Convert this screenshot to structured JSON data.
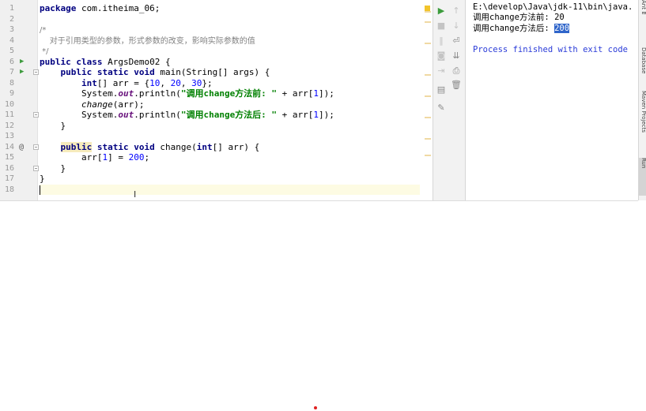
{
  "editor": {
    "line_numbers": [
      "1",
      "2",
      "3",
      "4",
      "5",
      "6",
      "7",
      "8",
      "9",
      "10",
      "11",
      "12",
      "13",
      "14",
      "15",
      "16",
      "17",
      "18"
    ],
    "lines": [
      [
        {
          "t": "package",
          "c": "kw"
        },
        {
          "t": " com.itheima_06;",
          "c": ""
        }
      ],
      [],
      [
        {
          "t": "/*",
          "c": "cmt"
        }
      ],
      [
        {
          "t": "    对于引用类型的参数，形式参数的改变，影响实际参数的值",
          "c": "cmt"
        }
      ],
      [
        {
          "t": " */",
          "c": "cmt"
        }
      ],
      [
        {
          "t": "public class",
          "c": "kw"
        },
        {
          "t": " ArgsDemo02 {",
          "c": ""
        }
      ],
      [
        {
          "t": "    ",
          "c": ""
        },
        {
          "t": "public static void",
          "c": "kw"
        },
        {
          "t": " main(String[] args) {",
          "c": ""
        }
      ],
      [
        {
          "t": "        ",
          "c": ""
        },
        {
          "t": "int",
          "c": "kw"
        },
        {
          "t": "[] arr = {",
          "c": ""
        },
        {
          "t": "10",
          "c": "num"
        },
        {
          "t": ", ",
          "c": ""
        },
        {
          "t": "20",
          "c": "num"
        },
        {
          "t": ", ",
          "c": ""
        },
        {
          "t": "30",
          "c": "num"
        },
        {
          "t": "};",
          "c": ""
        }
      ],
      [
        {
          "t": "        System.",
          "c": ""
        },
        {
          "t": "out",
          "c": "field"
        },
        {
          "t": ".println(",
          "c": ""
        },
        {
          "t": "\"调用change方法前: \"",
          "c": "str"
        },
        {
          "t": " + arr[",
          "c": ""
        },
        {
          "t": "1",
          "c": "num"
        },
        {
          "t": "]);",
          "c": ""
        }
      ],
      [
        {
          "t": "        ",
          "c": ""
        },
        {
          "t": "change",
          "c": "ital"
        },
        {
          "t": "(arr);",
          "c": ""
        }
      ],
      [
        {
          "t": "        System.",
          "c": ""
        },
        {
          "t": "out",
          "c": "field"
        },
        {
          "t": ".println(",
          "c": ""
        },
        {
          "t": "\"调用change方法后: \"",
          "c": "str"
        },
        {
          "t": " + arr[",
          "c": ""
        },
        {
          "t": "1",
          "c": "num"
        },
        {
          "t": "]);",
          "c": ""
        }
      ],
      [
        {
          "t": "    }",
          "c": ""
        }
      ],
      [],
      [
        {
          "t": "    ",
          "c": ""
        },
        {
          "t": "public",
          "c": "kw warn"
        },
        {
          "t": " ",
          "c": ""
        },
        {
          "t": "static void",
          "c": "kw"
        },
        {
          "t": " change(",
          "c": ""
        },
        {
          "t": "int",
          "c": "kw"
        },
        {
          "t": "[] arr) {",
          "c": ""
        }
      ],
      [
        {
          "t": "        arr[",
          "c": ""
        },
        {
          "t": "1",
          "c": "num"
        },
        {
          "t": "] = ",
          "c": ""
        },
        {
          "t": "200",
          "c": "num"
        },
        {
          "t": ";",
          "c": ""
        }
      ],
      [
        {
          "t": "    }",
          "c": ""
        }
      ],
      [
        {
          "t": "}",
          "c": ""
        }
      ],
      []
    ],
    "gutter_markers": {
      "run_arrows": [
        6,
        7
      ],
      "override_marker": 14,
      "fold_markers": [
        7,
        11,
        14,
        16
      ]
    },
    "current_line": 18,
    "mouse_cursor_glyph": "I"
  },
  "run_panel": {
    "toolbar_left": [
      {
        "icon": "run-icon",
        "glyph": "▶",
        "tone": "green"
      },
      {
        "icon": "stop-icon",
        "glyph": "■",
        "tone": "dim"
      },
      {
        "icon": "pause-icon",
        "glyph": "‖",
        "tone": "dim"
      },
      {
        "icon": "camera-icon",
        "glyph": "◙",
        "tone": "dim"
      },
      {
        "icon": "exit-icon",
        "glyph": "⇥",
        "tone": "dim"
      },
      {
        "icon": "layout-icon",
        "glyph": "▤",
        "tone": ""
      },
      {
        "icon": "pin-icon",
        "glyph": "✎",
        "tone": ""
      }
    ],
    "toolbar_right": [
      {
        "icon": "up-arrow-icon",
        "glyph": "↑",
        "tone": "dim"
      },
      {
        "icon": "down-arrow-icon",
        "glyph": "↓",
        "tone": "dim"
      },
      {
        "icon": "soft-wrap-icon",
        "glyph": "⏎",
        "tone": ""
      },
      {
        "icon": "scroll-to-end-icon",
        "glyph": "⇊",
        "tone": ""
      },
      {
        "icon": "print-icon",
        "glyph": "⎙",
        "tone": ""
      },
      {
        "icon": "trash-icon",
        "glyph": "🗑",
        "tone": ""
      }
    ],
    "console": {
      "command": "E:\\develop\\Java\\jdk-11\\bin\\java.",
      "output_before": "调用change方法前: 20",
      "output_after_prefix": "调用change方法后: ",
      "output_after_value": "200",
      "finished": "Process finished with exit code"
    }
  },
  "side_tabs": [
    {
      "label": "Ant Build",
      "active": false
    },
    {
      "label": "Database",
      "active": false
    },
    {
      "label": "Maven Projects",
      "active": false
    },
    {
      "label": "Run",
      "active": true
    }
  ],
  "colors": {
    "keyword": "#000080",
    "number": "#0000ff",
    "string": "#008000",
    "comment": "#808080",
    "selection": "#2f65ca",
    "console_info": "#2a3bd8"
  }
}
